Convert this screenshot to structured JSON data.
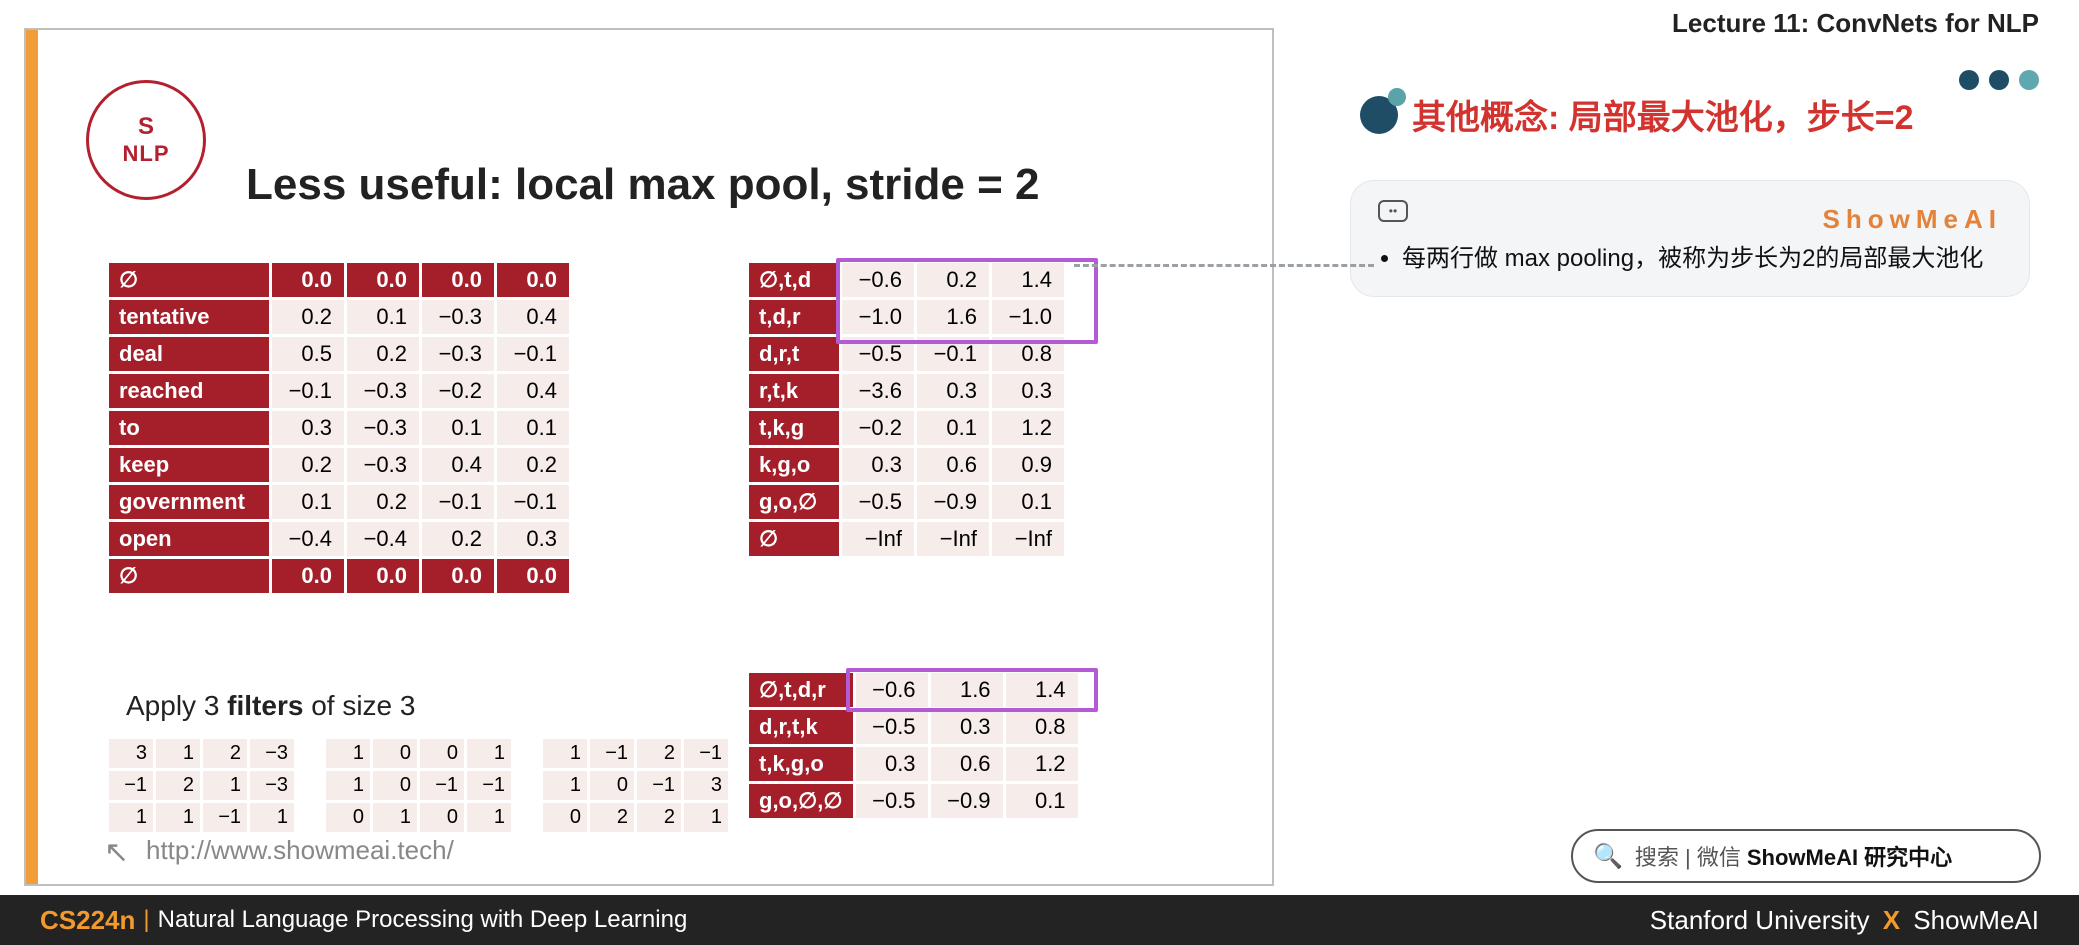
{
  "header_right": "Lecture 11: ConvNets for NLP",
  "section_title": "其他概念: 局部最大池化，步长=2",
  "note": {
    "brand": "ShowMeAI",
    "bullet": "每两行做 max pooling，被称为步长为2的局部最大池化"
  },
  "slide": {
    "title": "Less useful: local max pool, stride = 2",
    "logo_top": "S",
    "logo_bottom": "NLP",
    "apply_prefix": "Apply 3 ",
    "apply_bold": "filters",
    "apply_suffix": " of size 3",
    "url": "http://www.showmeai.tech/"
  },
  "table_input": {
    "rows": [
      {
        "lab": "∅",
        "v": [
          "0.0",
          "0.0",
          "0.0",
          "0.0"
        ],
        "bold": true
      },
      {
        "lab": "tentative",
        "v": [
          "0.2",
          "0.1",
          "−0.3",
          "0.4"
        ]
      },
      {
        "lab": "deal",
        "v": [
          "0.5",
          "0.2",
          "−0.3",
          "−0.1"
        ]
      },
      {
        "lab": "reached",
        "v": [
          "−0.1",
          "−0.3",
          "−0.2",
          "0.4"
        ]
      },
      {
        "lab": "to",
        "v": [
          "0.3",
          "−0.3",
          "0.1",
          "0.1"
        ]
      },
      {
        "lab": "keep",
        "v": [
          "0.2",
          "−0.3",
          "0.4",
          "0.2"
        ]
      },
      {
        "lab": "government",
        "v": [
          "0.1",
          "0.2",
          "−0.1",
          "−0.1"
        ]
      },
      {
        "lab": "open",
        "v": [
          "−0.4",
          "−0.4",
          "0.2",
          "0.3"
        ]
      },
      {
        "lab": "∅",
        "v": [
          "0.0",
          "0.0",
          "0.0",
          "0.0"
        ],
        "bold": true
      }
    ]
  },
  "table_conv": {
    "rows": [
      {
        "lab": "∅,t,d",
        "v": [
          "−0.6",
          "0.2",
          "1.4"
        ]
      },
      {
        "lab": "t,d,r",
        "v": [
          "−1.0",
          "1.6",
          "−1.0"
        ]
      },
      {
        "lab": "d,r,t",
        "v": [
          "−0.5",
          "−0.1",
          "0.8"
        ]
      },
      {
        "lab": "r,t,k",
        "v": [
          "−3.6",
          "0.3",
          "0.3"
        ]
      },
      {
        "lab": "t,k,g",
        "v": [
          "−0.2",
          "0.1",
          "1.2"
        ]
      },
      {
        "lab": "k,g,o",
        "v": [
          "0.3",
          "0.6",
          "0.9"
        ]
      },
      {
        "lab": "g,o,∅",
        "v": [
          "−0.5",
          "−0.9",
          "0.1"
        ]
      },
      {
        "lab": "∅",
        "v": [
          "−Inf",
          "−Inf",
          "−Inf"
        ]
      }
    ]
  },
  "table_pool": {
    "rows": [
      {
        "lab": "∅,t,d,r",
        "v": [
          "−0.6",
          "1.6",
          "1.4"
        ]
      },
      {
        "lab": "d,r,t,k",
        "v": [
          "−0.5",
          "0.3",
          "0.8"
        ]
      },
      {
        "lab": "t,k,g,o",
        "v": [
          "0.3",
          "0.6",
          "1.2"
        ]
      },
      {
        "lab": "g,o,∅,∅",
        "v": [
          "−0.5",
          "−0.9",
          "0.1"
        ]
      }
    ]
  },
  "filters": [
    [
      [
        "3",
        "1",
        "2",
        "−3"
      ],
      [
        "−1",
        "2",
        "1",
        "−3"
      ],
      [
        "1",
        "1",
        "−1",
        "1"
      ]
    ],
    [
      [
        "1",
        "0",
        "0",
        "1"
      ],
      [
        "1",
        "0",
        "−1",
        "−1"
      ],
      [
        "0",
        "1",
        "0",
        "1"
      ]
    ],
    [
      [
        "1",
        "−1",
        "2",
        "−1"
      ],
      [
        "1",
        "0",
        "−1",
        "3"
      ],
      [
        "0",
        "2",
        "2",
        "1"
      ]
    ]
  ],
  "search": {
    "icon": "🔍",
    "hint": "搜索 | 微信 ",
    "strong": "ShowMeAI 研究中心"
  },
  "footer": {
    "course": "CS224n",
    "sep": "|",
    "sub": "Natural Language Processing with Deep Learning",
    "right_a": "Stanford University",
    "right_x": "X",
    "right_b": "ShowMeAI"
  },
  "chart_data": {
    "type": "table",
    "title": "Less useful: local max pool, stride = 2",
    "input_embeddings": {
      "tokens": [
        "∅",
        "tentative",
        "deal",
        "reached",
        "to",
        "keep",
        "government",
        "open",
        "∅"
      ],
      "values": [
        [
          0.0,
          0.0,
          0.0,
          0.0
        ],
        [
          0.2,
          0.1,
          -0.3,
          0.4
        ],
        [
          0.5,
          0.2,
          -0.3,
          -0.1
        ],
        [
          -0.1,
          -0.3,
          -0.2,
          0.4
        ],
        [
          0.3,
          -0.3,
          0.1,
          0.1
        ],
        [
          0.2,
          -0.3,
          0.4,
          0.2
        ],
        [
          0.1,
          0.2,
          -0.1,
          -0.1
        ],
        [
          -0.4,
          -0.4,
          0.2,
          0.3
        ],
        [
          0.0,
          0.0,
          0.0,
          0.0
        ]
      ]
    },
    "filters_size": 3,
    "num_filters": 3,
    "filters": [
      [
        [
          3,
          1,
          2,
          -3
        ],
        [
          -1,
          2,
          1,
          -3
        ],
        [
          1,
          1,
          -1,
          1
        ]
      ],
      [
        [
          1,
          0,
          0,
          1
        ],
        [
          1,
          0,
          -1,
          -1
        ],
        [
          0,
          1,
          0,
          1
        ]
      ],
      [
        [
          1,
          -1,
          2,
          -1
        ],
        [
          1,
          0,
          -1,
          3
        ],
        [
          0,
          2,
          2,
          1
        ]
      ]
    ],
    "conv_output": {
      "windows": [
        "∅,t,d",
        "t,d,r",
        "d,r,t",
        "r,t,k",
        "t,k,g",
        "k,g,o",
        "g,o,∅",
        "∅"
      ],
      "values": [
        [
          -0.6,
          0.2,
          1.4
        ],
        [
          -1.0,
          1.6,
          -1.0
        ],
        [
          -0.5,
          -0.1,
          0.8
        ],
        [
          -3.6,
          0.3,
          0.3
        ],
        [
          -0.2,
          0.1,
          1.2
        ],
        [
          0.3,
          0.6,
          0.9
        ],
        [
          -0.5,
          -0.9,
          0.1
        ],
        [
          "-Inf",
          "-Inf",
          "-Inf"
        ]
      ]
    },
    "local_max_pool_stride2": {
      "windows": [
        "∅,t,d,r",
        "d,r,t,k",
        "t,k,g,o",
        "g,o,∅,∅"
      ],
      "values": [
        [
          -0.6,
          1.6,
          1.4
        ],
        [
          -0.5,
          0.3,
          0.8
        ],
        [
          0.3,
          0.6,
          1.2
        ],
        [
          -0.5,
          -0.9,
          0.1
        ]
      ]
    }
  }
}
